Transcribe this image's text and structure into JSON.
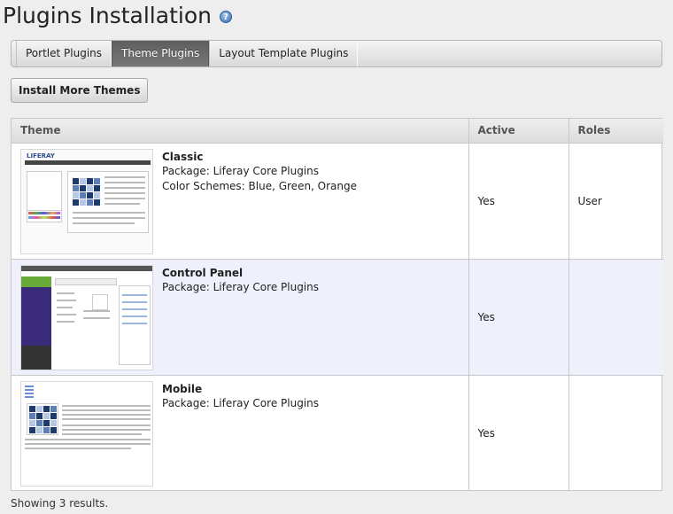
{
  "page": {
    "title": "Plugins Installation"
  },
  "tabs": [
    {
      "label": "Portlet Plugins",
      "active": false
    },
    {
      "label": "Theme Plugins",
      "active": true
    },
    {
      "label": "Layout Template Plugins",
      "active": false
    }
  ],
  "actions": {
    "install_label": "Install More Themes"
  },
  "table": {
    "columns": [
      "Theme",
      "Active",
      "Roles"
    ],
    "rows": [
      {
        "name": "Classic",
        "package": "Package: Liferay Core Plugins",
        "schemes": "Color Schemes: Blue, Green, Orange",
        "active": "Yes",
        "roles": "User"
      },
      {
        "name": "Control Panel",
        "package": "Package: Liferay Core Plugins",
        "schemes": "",
        "active": "Yes",
        "roles": ""
      },
      {
        "name": "Mobile",
        "package": "Package: Liferay Core Plugins",
        "schemes": "",
        "active": "Yes",
        "roles": ""
      }
    ]
  },
  "thumbnails": {
    "classic_logo": "LIFERAY"
  },
  "footer": {
    "results_text": "Showing 3 results."
  },
  "colors": {
    "active_tab": "#5e5e5e",
    "alt_row": "#eef1fb",
    "grid_dark": "#1c3a6b",
    "grid_mid": "#5d7fb5",
    "grid_light": "#b6c8e4"
  }
}
